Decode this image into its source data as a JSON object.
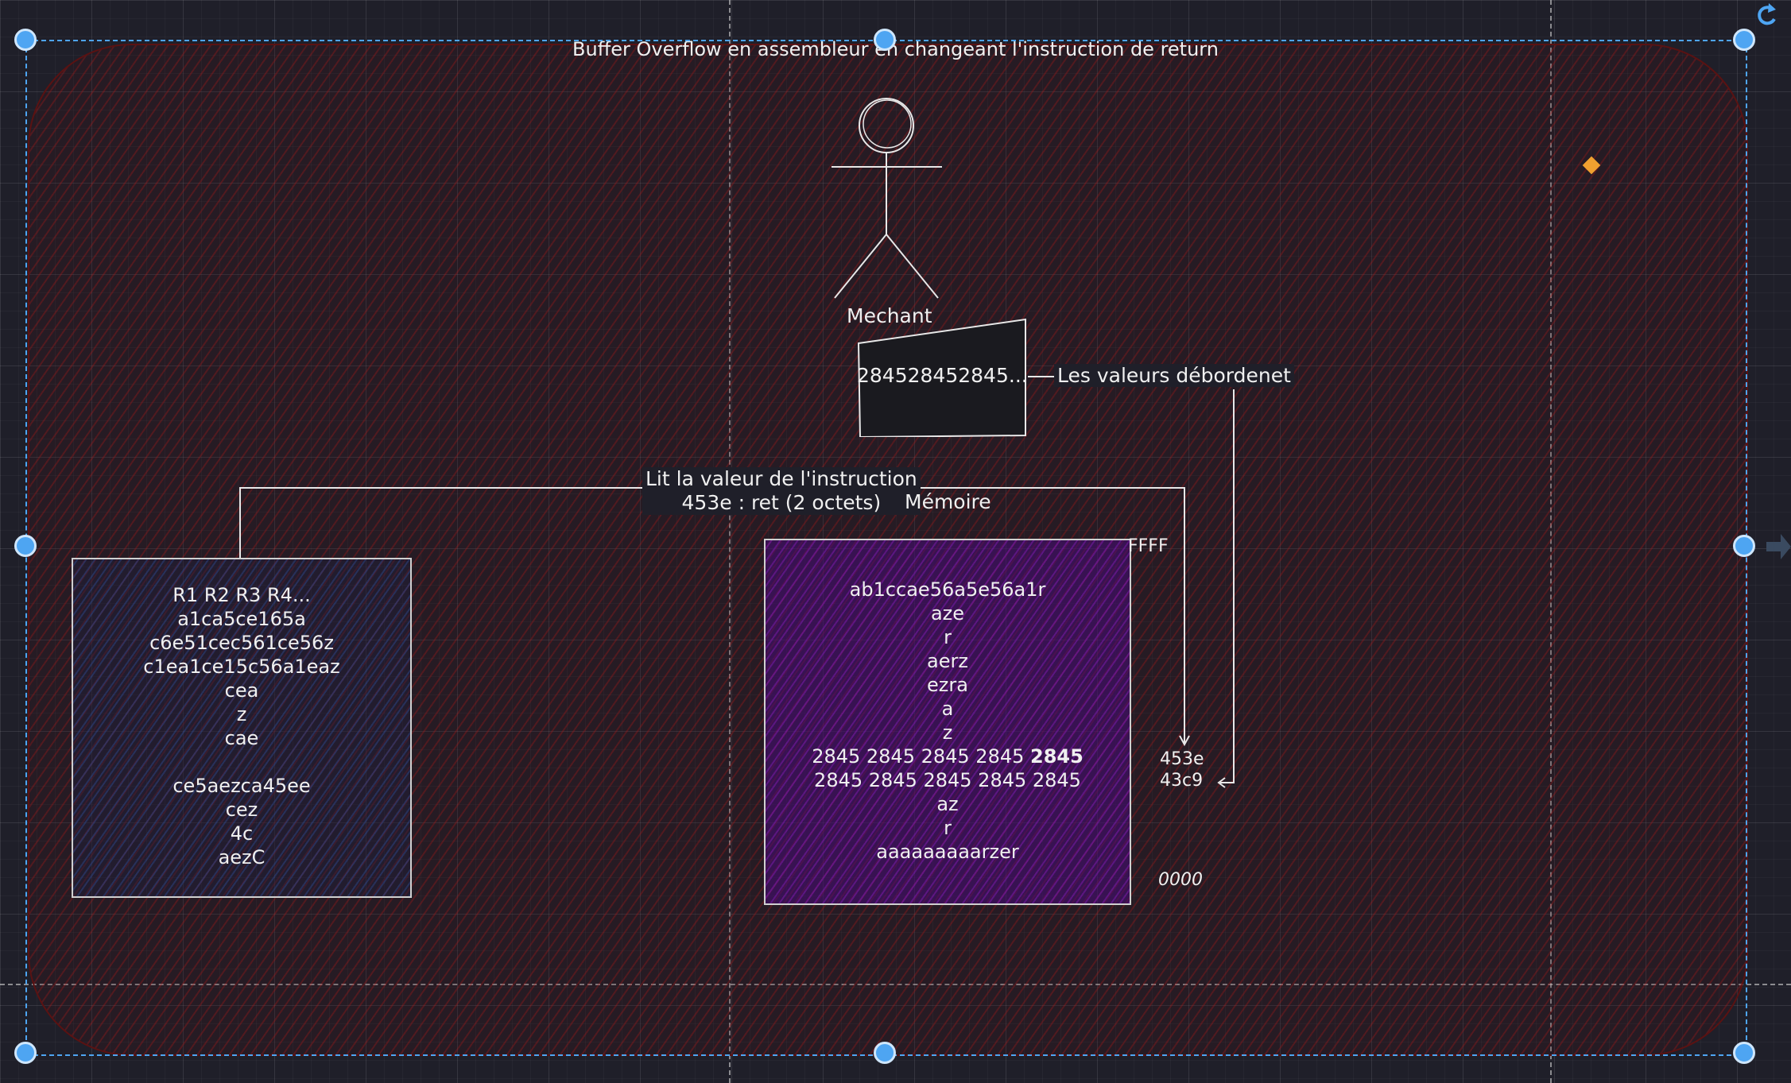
{
  "title": "Buffer Overflow en assembleur en changeant l'instruction de return",
  "actor": {
    "label": "Mechant"
  },
  "input_box": {
    "text": "284528452845..."
  },
  "overflow_label": "Les valeurs débordenet",
  "read_label": {
    "line1": "Lit la valeur de l'instruction",
    "line2": "453e : ret (2 octets)"
  },
  "memory_label": "Mémoire",
  "registers": {
    "lines": [
      "R1 R2 R3 R4...",
      "a1ca5ce165a",
      "c6e51cec561ce56z",
      "c1ea1ce15c56a1eaz",
      "cea",
      "z",
      "cae",
      "",
      "ce5aezca45ee",
      "cez",
      "4c",
      "aezC"
    ]
  },
  "memory": {
    "lines": [
      "ab1ccae56a5e56a1r",
      "aze",
      "r",
      "aerz",
      "ezra",
      "a",
      "z"
    ],
    "row1": {
      "prefix": "2845 2845 2845 2845 ",
      "bold": "2845"
    },
    "row2": "2845 2845 2845 2845 2845",
    "tail": [
      "az",
      "r",
      "aaaaaaaaarzer"
    ]
  },
  "addresses": {
    "top": "FFFF",
    "ret": "453e",
    "next": "43c9",
    "bottom": "0000"
  },
  "colors": {
    "accent": "#4ea5f2",
    "frame": "#5a1212",
    "memory_fill": "#5a1a8f",
    "marker": "#f0a030"
  }
}
